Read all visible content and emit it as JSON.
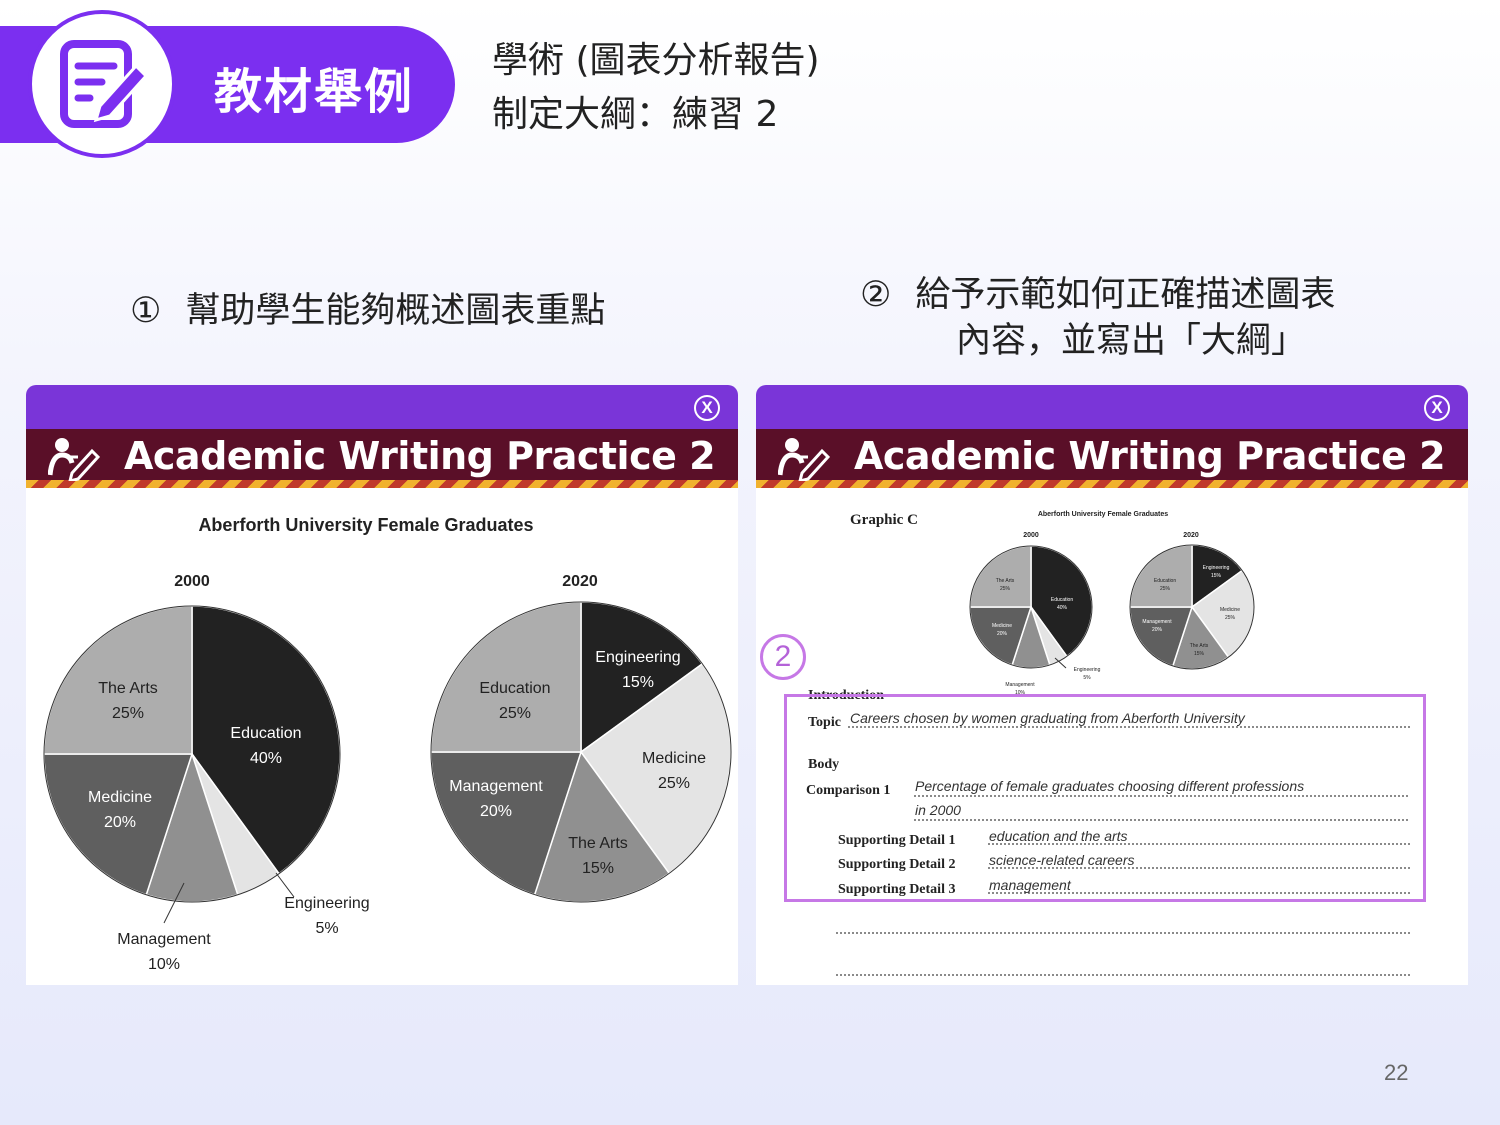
{
  "banner": {
    "title": "教材舉例",
    "logo_icon": "edit-note-icon",
    "color": "#7b2ff0"
  },
  "heading": {
    "line1": "學術 (圖表分析報告)",
    "line2": "制定大綱：練習 2"
  },
  "points": [
    {
      "num": "①",
      "text": "幫助學生能夠概述圖表重點"
    },
    {
      "num": "②",
      "line1": "給予示範如何正確描述圖表",
      "line2": "內容，並寫出「大綱」"
    }
  ],
  "panels": [
    {
      "title": "Academic Writing Practice 2",
      "close": "X",
      "icon": "writer-icon"
    },
    {
      "title": "Academic Writing Practice 2",
      "close": "X",
      "icon": "writer-icon"
    }
  ],
  "chart_data": [
    {
      "type": "pie",
      "title": "Aberforth University Female Graduates",
      "pies": [
        {
          "label": "2000",
          "slices": [
            {
              "name": "Education",
              "value": 40,
              "color": "#222222"
            },
            {
              "name": "Engineering",
              "value": 5,
              "color": "#e4e4e4"
            },
            {
              "name": "Management",
              "value": 10,
              "color": "#909090"
            },
            {
              "name": "Medicine",
              "value": 20,
              "color": "#5f5f5f"
            },
            {
              "name": "The Arts",
              "value": 25,
              "color": "#adadad"
            }
          ]
        },
        {
          "label": "2020",
          "slices": [
            {
              "name": "Engineering",
              "value": 15,
              "color": "#222222"
            },
            {
              "name": "Medicine",
              "value": 25,
              "color": "#e4e4e4"
            },
            {
              "name": "The Arts",
              "value": 15,
              "color": "#909090"
            },
            {
              "name": "Management",
              "value": 20,
              "color": "#5f5f5f"
            },
            {
              "name": "Education",
              "value": 25,
              "color": "#adadad"
            }
          ]
        }
      ]
    }
  ],
  "worksheet": {
    "graphic_label": "Graphic C",
    "mini_title": "Aberforth University Female Graduates",
    "intro_label": "Introduction",
    "topic_label": "Topic",
    "topic_value": "Careers chosen by women graduating from Aberforth University",
    "body_label": "Body",
    "comparison_label": "Comparison 1",
    "comparison_value_1": "Percentage of female graduates choosing different professions",
    "comparison_value_2": "in 2000",
    "details": [
      {
        "label": "Supporting Detail 1",
        "value": "education and the arts"
      },
      {
        "label": "Supporting Detail 2",
        "value": "science-related careers"
      },
      {
        "label": "Supporting Detail 3",
        "value": "management"
      }
    ],
    "marker": "2",
    "highlight_color": "#c678e6"
  },
  "page_number": "22"
}
